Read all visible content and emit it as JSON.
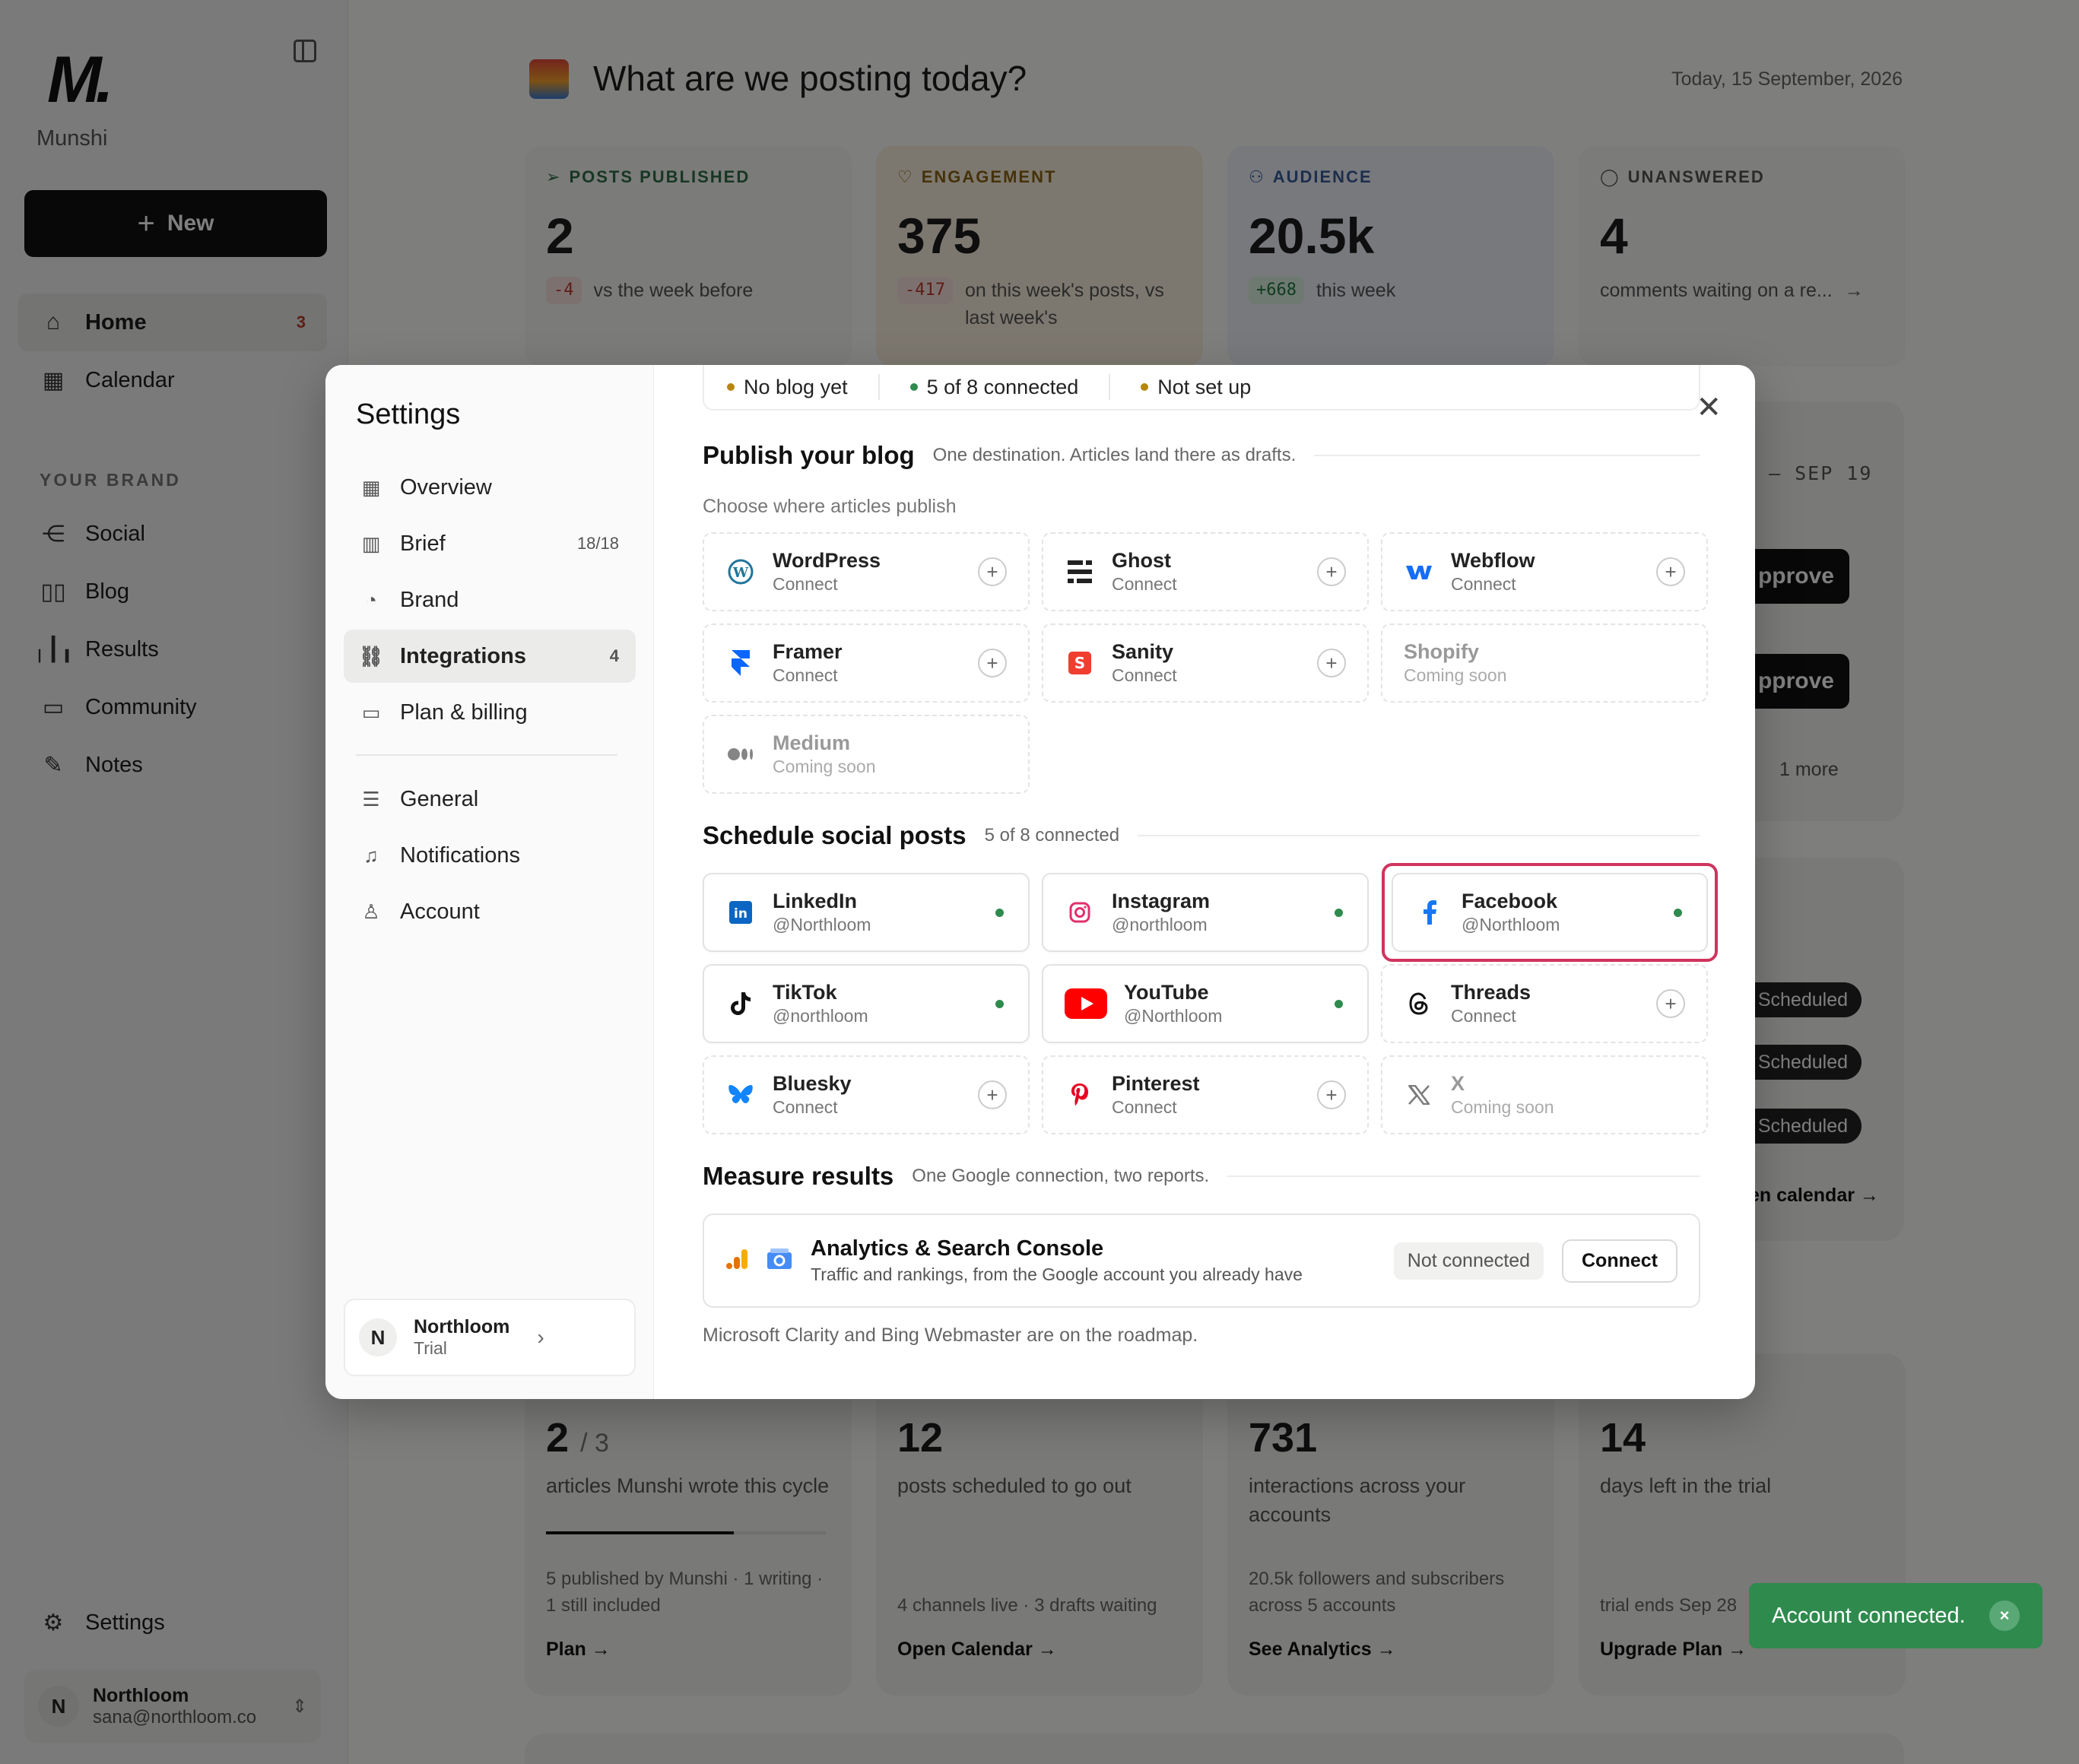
{
  "sidebar": {
    "brand": "Munshi",
    "new_label": "New",
    "nav": [
      {
        "label": "Home",
        "badge": "3"
      },
      {
        "label": "Calendar"
      }
    ],
    "section_label": "YOUR BRAND",
    "brand_nav": [
      {
        "label": "Social"
      },
      {
        "label": "Blog"
      },
      {
        "label": "Results"
      },
      {
        "label": "Community"
      },
      {
        "label": "Notes"
      }
    ],
    "settings_label": "Settings",
    "user": {
      "initial": "N",
      "name": "Northloom",
      "email": "sana@northloom.co"
    }
  },
  "main": {
    "title": "What are we posting today?",
    "date": "Today, 15 September, 2026",
    "stats": [
      {
        "label": "POSTS PUBLISHED",
        "value": "2",
        "delta": "-4",
        "note": "vs the week before",
        "color": "#2f6f46"
      },
      {
        "label": "ENGAGEMENT",
        "value": "375",
        "delta": "-417",
        "note": "on this week's posts, vs last week's",
        "color": "#8a6414"
      },
      {
        "label": "AUDIENCE",
        "value": "20.5k",
        "delta": "+668",
        "note": "this week",
        "color": "#3a5d9a"
      },
      {
        "label": "UNANSWERED",
        "value": "4",
        "note": "comments waiting on a re...",
        "color": "#555555"
      }
    ],
    "week_range": "– SEP 19",
    "approve_label": "pprove",
    "more_label": "1 more",
    "scheduled_label": "Scheduled",
    "calendar_link": "en calendar →",
    "bottom_cards": [
      {
        "big": "2",
        "big_suffix": "/ 3",
        "desc": "articles Munshi wrote this cycle",
        "progress": 0.67,
        "foot": "5 published by Munshi · 1 writing · 1 still included",
        "link": "Plan →"
      },
      {
        "big": "12",
        "desc": "posts scheduled to go out",
        "foot": "4 channels live · 3 drafts waiting",
        "link": "Open Calendar →"
      },
      {
        "big": "731",
        "desc": "interactions across your accounts",
        "foot": "20.5k followers and subscribers across 5 accounts",
        "link": "See Analytics →"
      },
      {
        "big": "14",
        "desc": "days left in the trial",
        "foot": "trial ends Sep 28",
        "link": "Upgrade Plan →"
      }
    ]
  },
  "toast": {
    "text": "Account connected.",
    "close": "×"
  },
  "settings": {
    "title": "Settings",
    "nav": [
      {
        "label": "Overview"
      },
      {
        "label": "Brief",
        "count": "18/18"
      },
      {
        "label": "Brand"
      },
      {
        "label": "Integrations",
        "count": "4"
      },
      {
        "label": "Plan & billing"
      },
      {
        "label": "General"
      },
      {
        "label": "Notifications"
      },
      {
        "label": "Account"
      }
    ],
    "workspace": {
      "initial": "N",
      "name": "Northloom",
      "plan": "Trial"
    },
    "status_strip": [
      "No blog yet",
      "5 of 8 connected",
      "Not set up"
    ],
    "blog": {
      "heading": "Publish your blog",
      "subheading": "One destination. Articles land there as drafts.",
      "choose_label": "Choose where articles publish",
      "tiles": [
        {
          "name": "WordPress",
          "sub": "Connect",
          "icon": "wordpress-icon"
        },
        {
          "name": "Ghost",
          "sub": "Connect",
          "icon": "ghost-icon"
        },
        {
          "name": "Webflow",
          "sub": "Connect",
          "icon": "webflow-icon"
        },
        {
          "name": "Framer",
          "sub": "Connect",
          "icon": "framer-icon"
        },
        {
          "name": "Sanity",
          "sub": "Connect",
          "icon": "sanity-icon"
        },
        {
          "name": "Shopify",
          "sub": "Coming soon",
          "icon": "shopify-icon"
        },
        {
          "name": "Medium",
          "sub": "Coming soon",
          "icon": "medium-icon"
        }
      ]
    },
    "social": {
      "heading": "Schedule social posts",
      "subheading": "5 of 8 connected",
      "tiles": [
        {
          "name": "LinkedIn",
          "sub": "@Northloom",
          "icon": "linkedin-icon"
        },
        {
          "name": "Instagram",
          "sub": "@northloom",
          "icon": "instagram-icon"
        },
        {
          "name": "Facebook",
          "sub": "@Northloom",
          "icon": "facebook-icon"
        },
        {
          "name": "TikTok",
          "sub": "@northloom",
          "icon": "tiktok-icon"
        },
        {
          "name": "YouTube",
          "sub": "@Northloom",
          "icon": "youtube-icon"
        },
        {
          "name": "Threads",
          "sub": "Connect",
          "icon": "threads-icon"
        },
        {
          "name": "Bluesky",
          "sub": "Connect",
          "icon": "bluesky-icon"
        },
        {
          "name": "Pinterest",
          "sub": "Connect",
          "icon": "pinterest-icon"
        },
        {
          "name": "X",
          "sub": "Coming soon",
          "icon": "x-icon"
        }
      ]
    },
    "measure": {
      "heading": "Measure results",
      "subheading": "One Google connection, two reports.",
      "title": "Analytics & Search Console",
      "sub": "Traffic and rankings, from the Google account you already have",
      "status": "Not connected",
      "button": "Connect",
      "roadmap": "Microsoft Clarity and Bing Webmaster are on the roadmap."
    },
    "colors": {
      "accent_highlight": "#d0345e",
      "connected": "#2f8a4e",
      "toast": "#2f8a4e"
    }
  }
}
